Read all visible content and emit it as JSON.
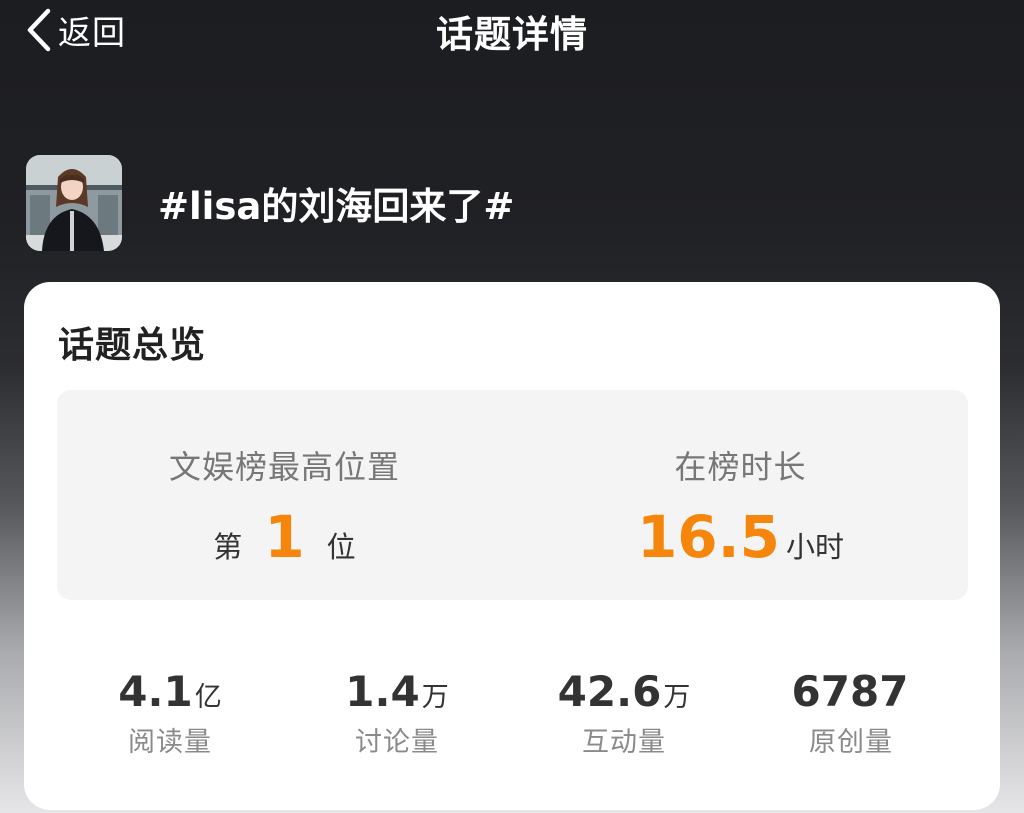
{
  "nav": {
    "back_label": "返回",
    "title": "话题详情",
    "back_icon": "chevron-left-icon"
  },
  "topic": {
    "title": "#lisa的刘海回来了#"
  },
  "overview": {
    "title": "话题总览",
    "rank": {
      "label": "文娱榜最高位置",
      "prefix": "第",
      "value": "1",
      "suffix": "位"
    },
    "duration": {
      "label": "在榜时长",
      "value": "16.5",
      "unit": "小时"
    },
    "stats": [
      {
        "value": "4.1",
        "unit": "亿",
        "label": "阅读量"
      },
      {
        "value": "1.4",
        "unit": "万",
        "label": "讨论量"
      },
      {
        "value": "42.6",
        "unit": "万",
        "label": "互动量"
      },
      {
        "value": "6787",
        "unit": "",
        "label": "原创量"
      }
    ]
  },
  "colors": {
    "accent": "#f5860b",
    "card_bg": "#ffffff",
    "panel_bg": "#f4f4f5"
  }
}
